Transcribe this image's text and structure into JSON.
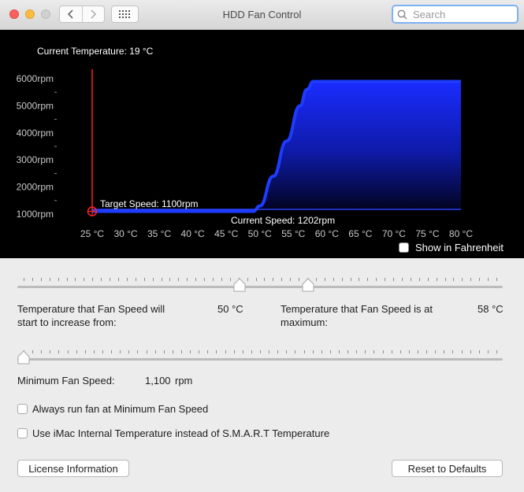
{
  "window": {
    "title": "HDD Fan Control"
  },
  "search": {
    "placeholder": "Search"
  },
  "chart": {
    "current_temperature": "Current Temperature: 19 °C",
    "target_speed": "Target Speed: 1100rpm",
    "current_speed": "Current Speed: 1202rpm",
    "y_labels": [
      "6000rpm",
      "5000rpm",
      "4000rpm",
      "3000rpm",
      "2000rpm",
      "1000rpm"
    ],
    "x_labels": [
      "25 °C",
      "30 °C",
      "35 °C",
      "40 °C",
      "45 °C",
      "50 °C",
      "55 °C",
      "60 °C",
      "65 °C",
      "70 °C",
      "75 °C",
      "80 °C"
    ],
    "show_fahrenheit": "Show in Fahrenheit",
    "colors": {
      "curve": "#1e3cff",
      "current_temp_line": "#ff2020"
    }
  },
  "chart_data": {
    "type": "area",
    "x": [
      25,
      49,
      50,
      52,
      54,
      56,
      57,
      58,
      80
    ],
    "y": [
      1100,
      1100,
      1300,
      2400,
      3700,
      5000,
      5600,
      5900,
      5900
    ],
    "ylim": [
      1000,
      6000
    ],
    "xlim": [
      25,
      80
    ],
    "current_temperature": 19,
    "target_speed": 1100,
    "current_speed": 1202
  },
  "controls": {
    "increase_from_label": "Temperature that Fan Speed will start to increase from:",
    "increase_from_value": "50 °C",
    "maximum_label": "Temperature that Fan Speed is at maximum:",
    "maximum_value": "58 °C",
    "min_speed_label": "Minimum Fan Speed:",
    "min_speed_value": "1,100",
    "min_speed_unit": "rpm",
    "always_run_label": "Always run fan at Minimum Fan Speed",
    "use_imac_label": "Use iMac Internal Temperature instead of S.M.A.R.T Temperature",
    "license_button": "License Information",
    "reset_button": "Reset to Defaults"
  }
}
